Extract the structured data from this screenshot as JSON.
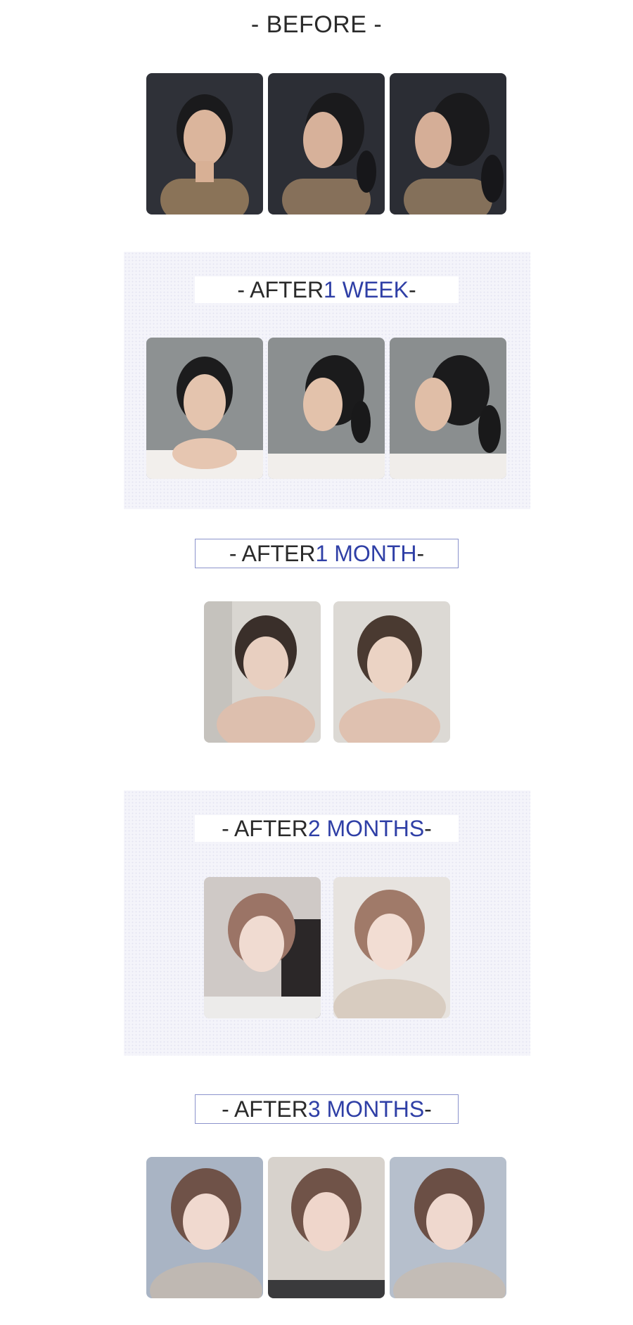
{
  "sections": {
    "before": {
      "title": "- BEFORE -"
    },
    "week1": {
      "prefix": "- AFTER ",
      "accent": "1 WEEK",
      "suffix": " -"
    },
    "month1": {
      "prefix": "- AFTER ",
      "accent": "1 MONTH",
      "suffix": " -"
    },
    "month2": {
      "prefix": "- AFTER ",
      "accent": "2 MONTHS",
      "suffix": " -"
    },
    "month3": {
      "prefix": "- AFTER ",
      "accent": "3 MONTHS",
      "suffix": " -"
    }
  },
  "colors": {
    "accent": "#2f3fa6",
    "panel_bg": "#f4f4fa",
    "label_border": "#8b93cc"
  }
}
